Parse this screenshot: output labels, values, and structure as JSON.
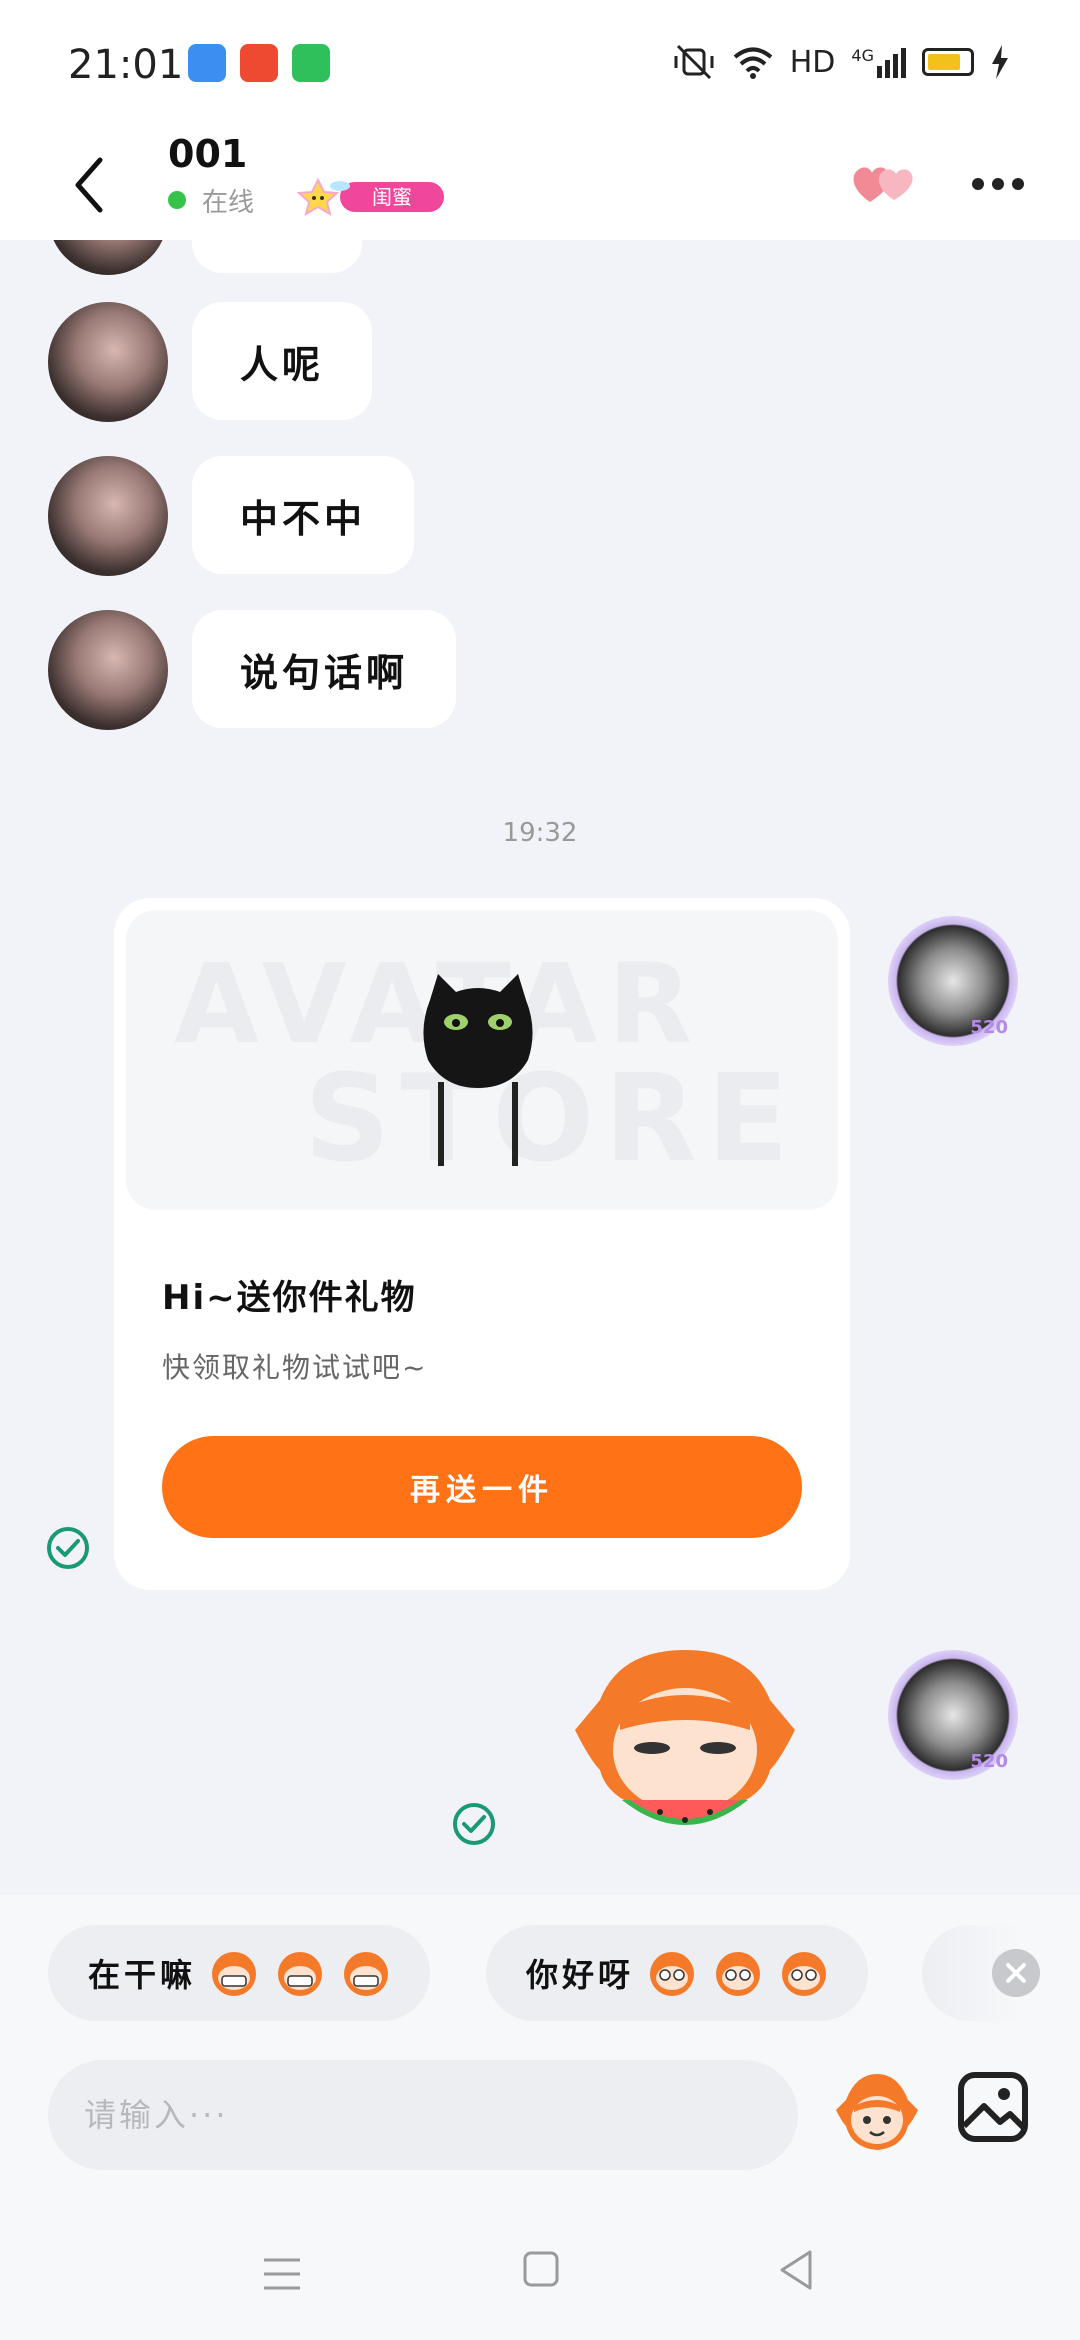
{
  "status_bar": {
    "time": "21:01",
    "network": "HD",
    "signal": "4G",
    "icons": [
      "mute-vibrate-icon",
      "wifi-icon",
      "signal-icon",
      "battery-icon",
      "charging-icon"
    ]
  },
  "header": {
    "title": "001",
    "status": "在线",
    "badge": "闺蜜",
    "icons": [
      "back-icon",
      "hearts-icon",
      "more-icon"
    ]
  },
  "messages": [
    {
      "text": "人呢"
    },
    {
      "text": "中不中"
    },
    {
      "text": "说句话啊"
    }
  ],
  "time_divider": "19:32",
  "gift_card": {
    "watermark": [
      "AVATAR",
      "STORE"
    ],
    "title": "Hi~送你件礼物",
    "subtitle": "快领取礼物试试吧~",
    "button": "再送一件"
  },
  "avatar_frame_tag": "520",
  "quick_replies": [
    {
      "text": "在干嘛"
    },
    {
      "text": "你好呀"
    }
  ],
  "input": {
    "placeholder": "请输入···"
  },
  "colors": {
    "accent": "#ff7216",
    "online": "#37c24a",
    "badge": "#f0479a",
    "check": "#1a9a74",
    "background": "#f1f3f8"
  }
}
